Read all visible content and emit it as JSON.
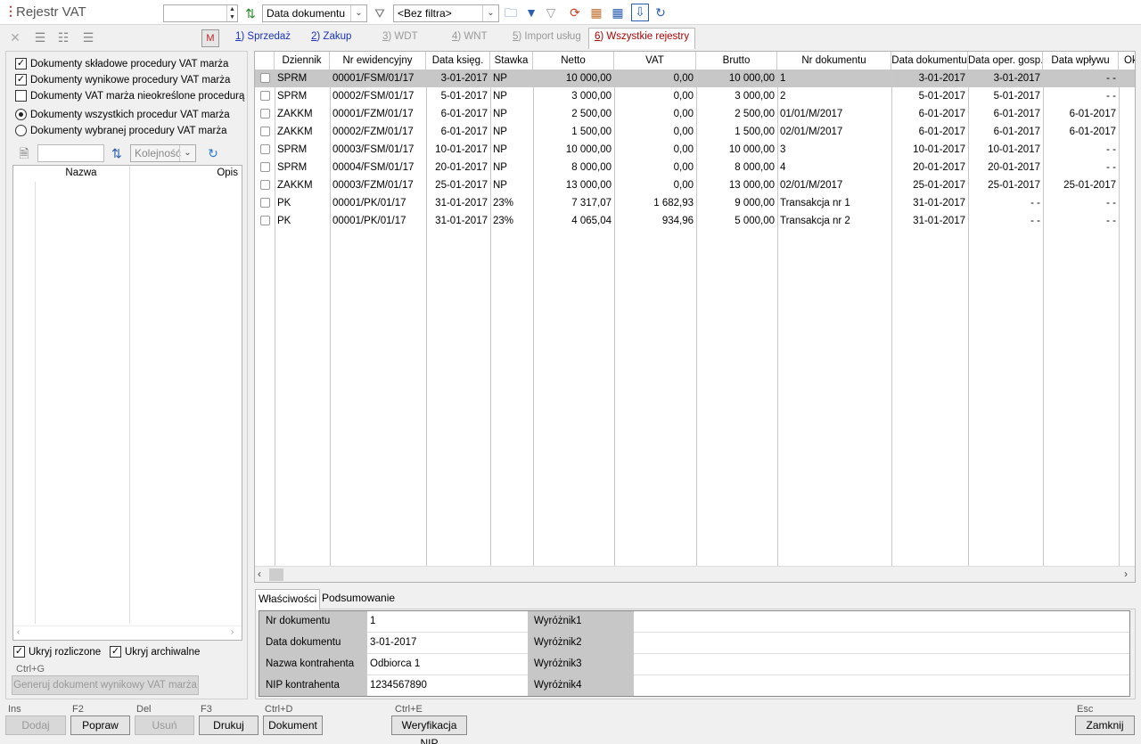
{
  "window": {
    "title": "Rejestr VAT"
  },
  "toolbar": {
    "sort_field": "Data dokumentu",
    "filter": "<Bez filtra>"
  },
  "tabs": [
    {
      "num": "1",
      "label": ") Sprzedaż",
      "state": "enabled"
    },
    {
      "num": "2",
      "label": ") Zakup",
      "state": "enabled"
    },
    {
      "num": "3",
      "label": ") WDT",
      "state": "disabled"
    },
    {
      "num": "4",
      "label": ") WNT",
      "state": "disabled"
    },
    {
      "num": "5",
      "label": ") Import usług",
      "state": "disabled"
    },
    {
      "num": "6",
      "label": ") Wszystkie rejestry",
      "state": "selected"
    }
  ],
  "left": {
    "checkboxes": [
      {
        "label": "Dokumenty składowe procedury VAT marża",
        "checked": true
      },
      {
        "label": "Dokumenty wynikowe procedury VAT marża",
        "checked": true
      },
      {
        "label": "Dokumenty VAT marża nieokreślone procedurą",
        "checked": false
      }
    ],
    "radios": [
      {
        "label": "Dokumenty wszystkich procedur VAT marża",
        "checked": true
      },
      {
        "label": "Dokumenty wybranej procedury VAT marża",
        "checked": false
      }
    ],
    "order_placeholder": "Kolejność",
    "list_headers": {
      "name": "Nazwa",
      "desc": "Opis"
    },
    "hide_settled": "Ukryj rozliczone",
    "hide_archived": "Ukryj archiwalne",
    "shortcut": "Ctrl+G",
    "generate_button": "Generuj dokument wynikowy VAT marża"
  },
  "grid": {
    "headers": [
      "Dziennik",
      "Nr ewidencyjny",
      "Data księg.",
      "Stawka",
      "Netto",
      "VAT",
      "Brutto",
      "Nr dokumentu",
      "Data dokumentu",
      "Data oper. gosp.",
      "Data wpływu",
      "Ok"
    ],
    "rows": [
      [
        "SPRM",
        "00001/FSM/01/17",
        "3-01-2017",
        "NP",
        "10 000,00",
        "0,00",
        "10 000,00",
        "1",
        "3-01-2017",
        "3-01-2017",
        "- -"
      ],
      [
        "SPRM",
        "00002/FSM/01/17",
        "5-01-2017",
        "NP",
        "3 000,00",
        "0,00",
        "3 000,00",
        "2",
        "5-01-2017",
        "5-01-2017",
        "- -"
      ],
      [
        "ZAKKM",
        "00001/FZM/01/17",
        "6-01-2017",
        "NP",
        "2 500,00",
        "0,00",
        "2 500,00",
        "01/01/M/2017",
        "6-01-2017",
        "6-01-2017",
        "6-01-2017"
      ],
      [
        "ZAKKM",
        "00002/FZM/01/17",
        "6-01-2017",
        "NP",
        "1 500,00",
        "0,00",
        "1 500,00",
        "02/01/M/2017",
        "6-01-2017",
        "6-01-2017",
        "6-01-2017"
      ],
      [
        "SPRM",
        "00003/FSM/01/17",
        "10-01-2017",
        "NP",
        "10 000,00",
        "0,00",
        "10 000,00",
        "3",
        "10-01-2017",
        "10-01-2017",
        "- -"
      ],
      [
        "SPRM",
        "00004/FSM/01/17",
        "20-01-2017",
        "NP",
        "8 000,00",
        "0,00",
        "8 000,00",
        "4",
        "20-01-2017",
        "20-01-2017",
        "- -"
      ],
      [
        "ZAKKM",
        "00003/FZM/01/17",
        "25-01-2017",
        "NP",
        "13 000,00",
        "0,00",
        "13 000,00",
        "02/01/M/2017",
        "25-01-2017",
        "25-01-2017",
        "25-01-2017"
      ],
      [
        "PK",
        "00001/PK/01/17",
        "31-01-2017",
        "23%",
        "7 317,07",
        "1 682,93",
        "9 000,00",
        "Transakcja nr 1",
        "31-01-2017",
        "- -",
        "- -"
      ],
      [
        "PK",
        "00001/PK/01/17",
        "31-01-2017",
        "23%",
        "4 065,04",
        "934,96",
        "5 000,00",
        "Transakcja nr 2",
        "31-01-2017",
        "- -",
        "- -"
      ]
    ]
  },
  "props": {
    "tab_props": "Właściwości",
    "tab_summary": "Podsumowanie",
    "fields": [
      {
        "label": "Nr dokumentu",
        "value": "1"
      },
      {
        "label": "Data dokumentu",
        "value": " 3-01-2017"
      },
      {
        "label": "Nazwa kontrahenta",
        "value": "Odbiorca 1"
      },
      {
        "label": "NIP kontrahenta",
        "value": "1234567890"
      }
    ],
    "extra": [
      "Wyróżnik1",
      "Wyróżnik2",
      "Wyróżnik3",
      "Wyróżnik4"
    ]
  },
  "bottom": {
    "buttons": [
      {
        "key": "Ins",
        "label": "Dodaj",
        "enabled": false
      },
      {
        "key": "F2",
        "label": "Popraw",
        "enabled": true
      },
      {
        "key": "Del",
        "label": "Usuń",
        "enabled": false
      },
      {
        "key": "F3",
        "label": "Drukuj",
        "enabled": true
      },
      {
        "key": "Ctrl+D",
        "label": "Dokument",
        "enabled": true
      },
      {
        "key": "Ctrl+E",
        "label": "Weryfikacja NIP",
        "enabled": true
      },
      {
        "key": "Esc",
        "label": "Zamknij",
        "enabled": true
      }
    ]
  }
}
